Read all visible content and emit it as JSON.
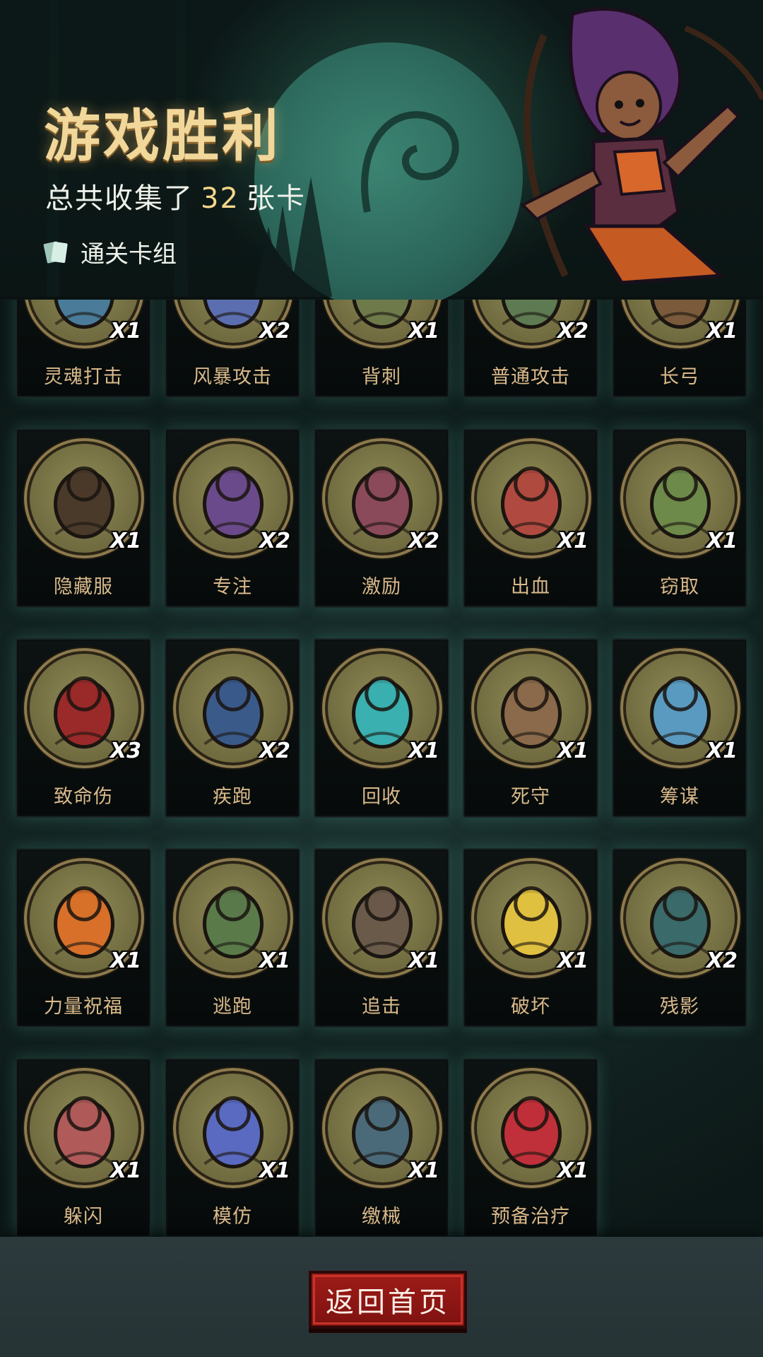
{
  "header": {
    "title": "游戏胜利",
    "collected_prefix": "总共收集了",
    "collected_count": "32",
    "collected_suffix": "张卡",
    "deck_label": "通关卡组"
  },
  "cards": [
    {
      "name": "灵魂打击",
      "count": "X1",
      "color": "#4a7c9a"
    },
    {
      "name": "风暴攻击",
      "count": "X2",
      "color": "#5b6fb0"
    },
    {
      "name": "背刺",
      "count": "X1",
      "color": "#6e7a4a"
    },
    {
      "name": "普通攻击",
      "count": "X2",
      "color": "#5e7a52"
    },
    {
      "name": "长弓",
      "count": "X1",
      "color": "#7a5a3a"
    },
    {
      "name": "隐藏服",
      "count": "X1",
      "color": "#4a3a2a"
    },
    {
      "name": "专注",
      "count": "X2",
      "color": "#6a4a8a"
    },
    {
      "name": "激励",
      "count": "X2",
      "color": "#8a4a5a"
    },
    {
      "name": "出血",
      "count": "X1",
      "color": "#b04a40"
    },
    {
      "name": "窃取",
      "count": "X1",
      "color": "#6e8a4a"
    },
    {
      "name": "致命伤",
      "count": "X3",
      "color": "#9a2a2a"
    },
    {
      "name": "疾跑",
      "count": "X2",
      "color": "#3a5a8a"
    },
    {
      "name": "回收",
      "count": "X1",
      "color": "#3ab0b0"
    },
    {
      "name": "死守",
      "count": "X1",
      "color": "#8a6a4a"
    },
    {
      "name": "筹谋",
      "count": "X1",
      "color": "#5a9ac0"
    },
    {
      "name": "力量祝福",
      "count": "X1",
      "color": "#d8702a"
    },
    {
      "name": "逃跑",
      "count": "X1",
      "color": "#5a7a4a"
    },
    {
      "name": "追击",
      "count": "X1",
      "color": "#6a5a4a"
    },
    {
      "name": "破坏",
      "count": "X1",
      "color": "#e0c040"
    },
    {
      "name": "残影",
      "count": "X2",
      "color": "#3a6a6a"
    },
    {
      "name": "躲闪",
      "count": "X1",
      "color": "#b05a5a"
    },
    {
      "name": "模仿",
      "count": "X1",
      "color": "#5a6ac0"
    },
    {
      "name": "缴械",
      "count": "X1",
      "color": "#4a6a7a"
    },
    {
      "name": "预备治疗",
      "count": "X1",
      "color": "#c0303a"
    }
  ],
  "footer": {
    "home_button": "返回首页"
  }
}
